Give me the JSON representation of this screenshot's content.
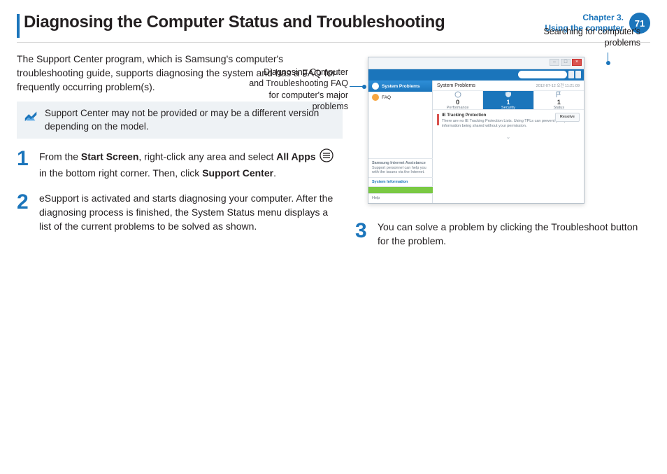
{
  "header": {
    "title": "Diagnosing the Computer Status and Troubleshooting",
    "chapter_line1": "Chapter 3.",
    "chapter_line2": "Using the computer",
    "page": "71"
  },
  "intro": "The Support Center program, which is Samsung's computer's troubleshooting guide, supports diagnosing the system and has a FAQ for frequently occurring problem(s).",
  "note": "Support Center may not be provided or may be a different version depending on the model.",
  "step1": {
    "p1": "From the ",
    "b1": "Start Screen",
    "p2": ", right-click any area and select ",
    "b2": "All Apps",
    "p3": " in the bottom right corner. Then, click ",
    "b3": "Support Center",
    "p4": "."
  },
  "step2": "eSupport is activated and starts diagnosing your computer. After the diagnosing process is finished, the System Status menu displays a list of the current problems to be solved as shown.",
  "step3": "You can solve a problem by clicking the Troubleshoot button for the problem.",
  "callouts": {
    "left": "Diagnosing Computer and Troubleshooting FAQ for computer's major problems",
    "right": "Searching for computer's problems"
  },
  "app": {
    "side_system": "System Problems",
    "side_faq": "FAQ",
    "content_title": "System Problems",
    "timestamp": "2012-07-12 오전 11:21:09",
    "tiles": {
      "perf": {
        "value": "0",
        "label": "Performance"
      },
      "sec": {
        "value": "1",
        "label": "Security"
      },
      "stat": {
        "value": "1",
        "label": "Status"
      }
    },
    "problem": {
      "title": "IE Tracking Protection",
      "desc": "There are no IE Tracking Protection Lists. Using TPLs can prevent your private information being shared without your permission.",
      "resolve": "Resolve"
    },
    "assist_title": "Samsung Internet Assistance",
    "assist_desc": "Support personnel can help you with the issues via the Internet.",
    "sysinfo": "System Information",
    "help": "Help"
  }
}
